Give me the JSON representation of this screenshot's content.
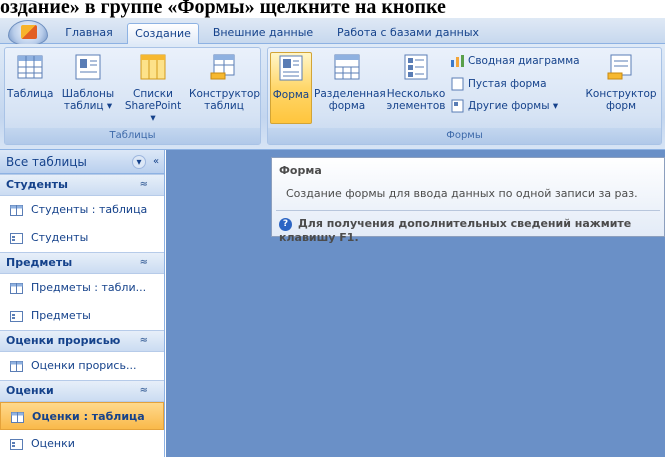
{
  "caption": {
    "text": "оздание» в группе «Формы» щелкните на кнопке"
  },
  "tabs": [
    {
      "label": "Главная"
    },
    {
      "label": "Создание",
      "active": true
    },
    {
      "label": "Внешние данные"
    },
    {
      "label": "Работа с базами данных"
    }
  ],
  "ribbon": {
    "tables_group": {
      "title": "Таблицы",
      "buttons": [
        {
          "label1": "Таблица",
          "label2": ""
        },
        {
          "label1": "Шаблоны",
          "label2": "таблиц ▾"
        },
        {
          "label1": "Списки",
          "label2": "SharePoint ▾"
        },
        {
          "label1": "Конструктор",
          "label2": "таблиц"
        }
      ]
    },
    "forms_group": {
      "title": "Формы",
      "buttons": [
        {
          "label1": "Форма",
          "label2": ""
        },
        {
          "label1": "Разделенная",
          "label2": "форма"
        },
        {
          "label1": "Несколько",
          "label2": "элементов"
        },
        {
          "label1": "Конструктор",
          "label2": "форм"
        }
      ],
      "small_buttons": [
        {
          "label": "Сводная диаграмма"
        },
        {
          "label": "Пустая форма"
        },
        {
          "label": "Другие формы ▾"
        }
      ]
    }
  },
  "nav": {
    "header": "Все таблицы",
    "groups": [
      {
        "title": "Студенты",
        "items": [
          {
            "label": "Студенты : таблица",
            "type": "table"
          },
          {
            "label": "Студенты",
            "type": "form"
          }
        ]
      },
      {
        "title": "Предметы",
        "items": [
          {
            "label": "Предметы : табли...",
            "type": "table"
          },
          {
            "label": "Предметы",
            "type": "form"
          }
        ]
      },
      {
        "title": "Оценки прорисью",
        "items": [
          {
            "label": "Оценки прорись...",
            "type": "table"
          }
        ]
      },
      {
        "title": "Оценки",
        "items": [
          {
            "label": "Оценки : таблица",
            "type": "table",
            "active": true
          },
          {
            "label": "Оценки",
            "type": "form"
          }
        ]
      }
    ]
  },
  "tooltip": {
    "title": "Форма",
    "description": "Создание формы для ввода данных по одной записи за раз.",
    "help": "Для получения дополнительных сведений нажмите клавишу F1."
  },
  "colors": {
    "workspace": "#6a90c7",
    "selected_button": "#ffc53d",
    "text": "#15428b"
  }
}
